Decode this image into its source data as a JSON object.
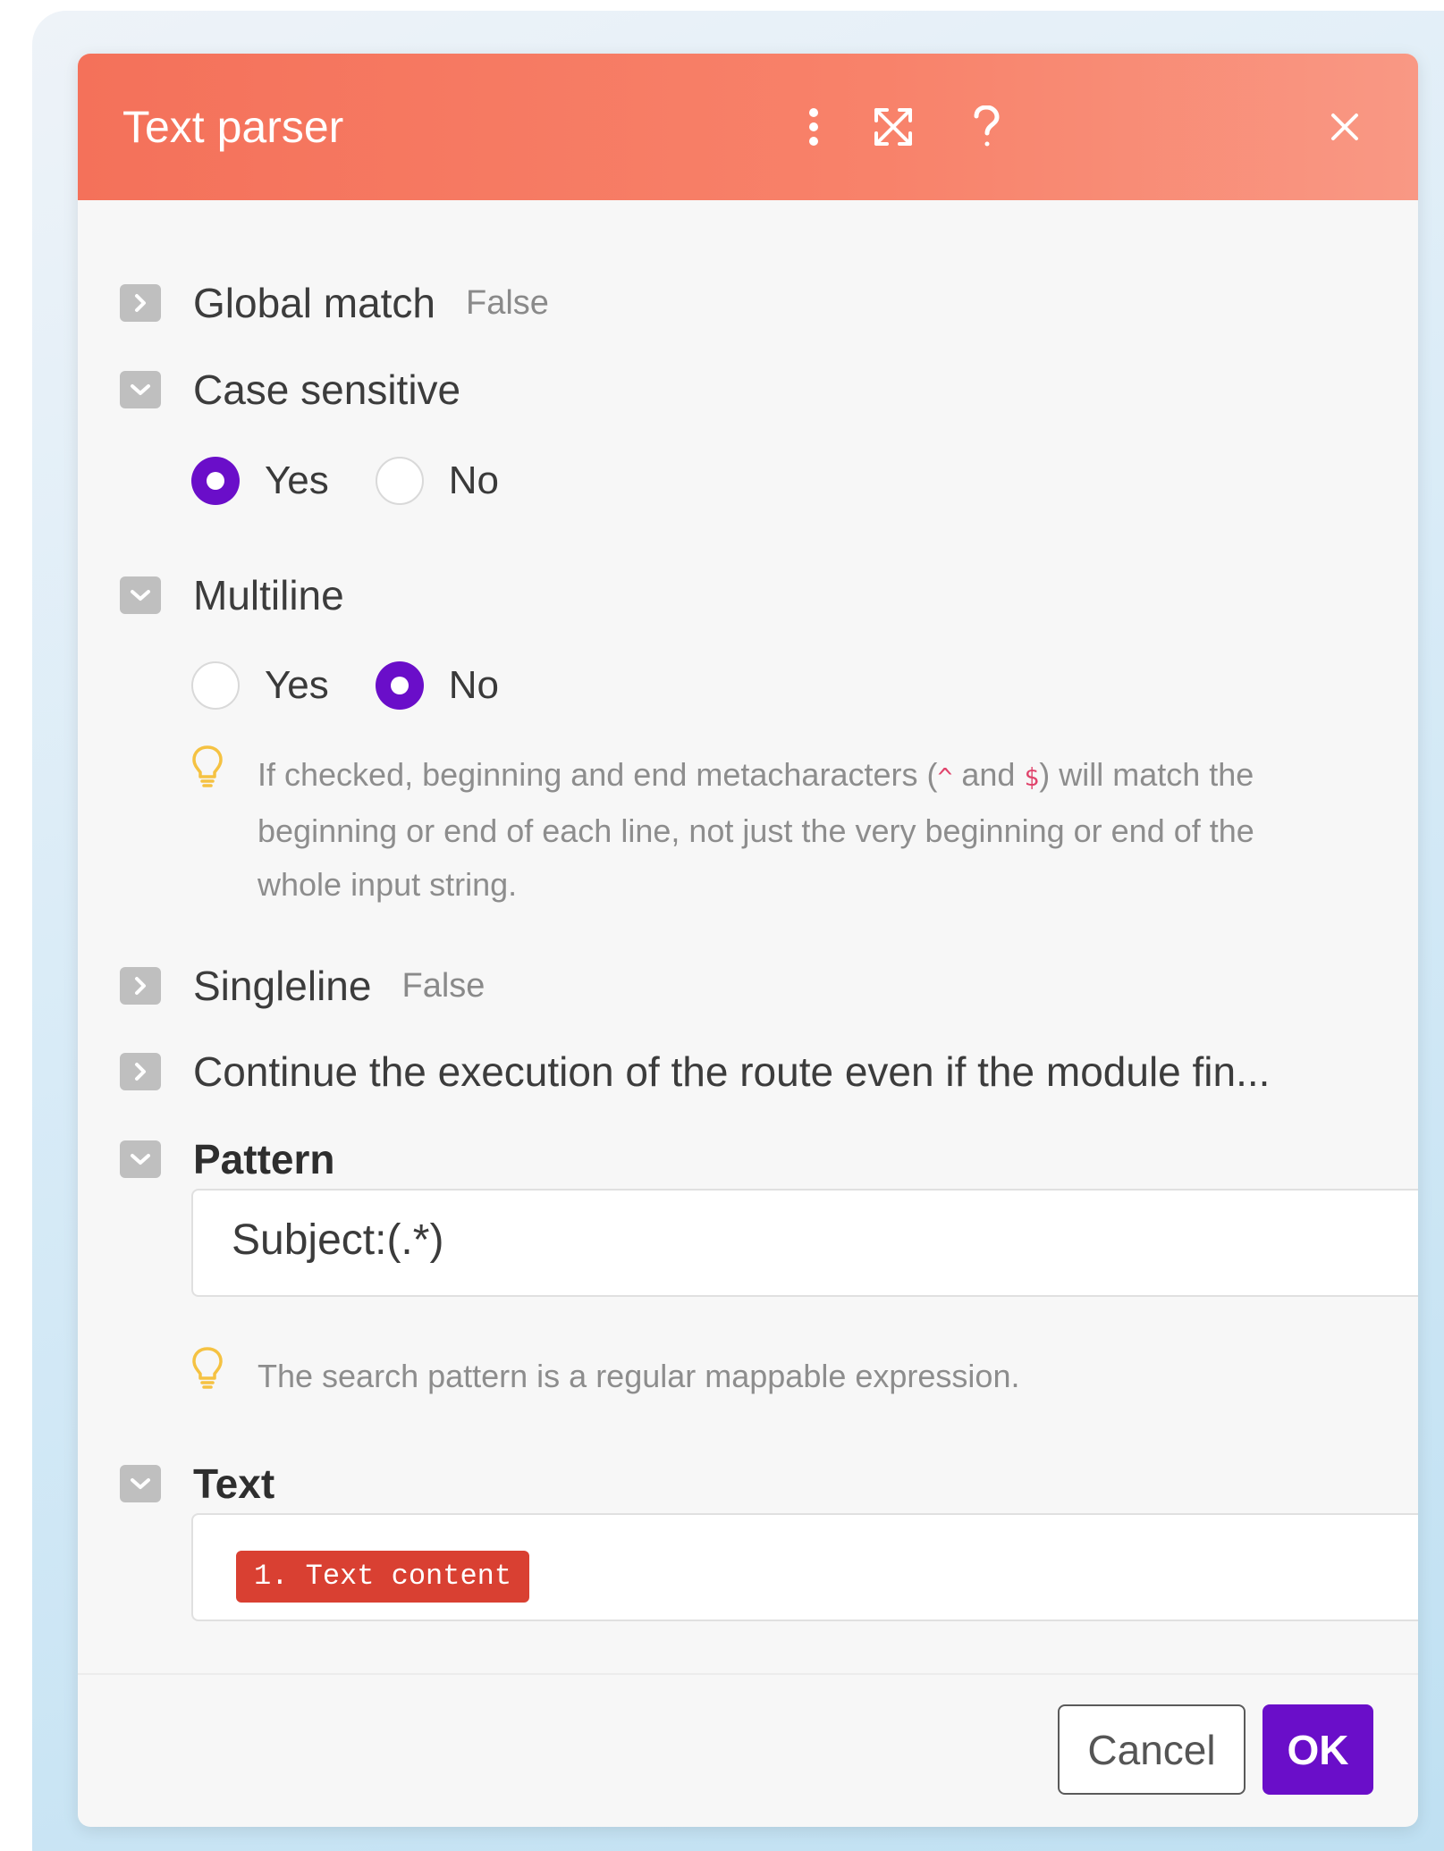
{
  "dialog": {
    "title": "Text parser",
    "header_icons": [
      "more-vertical-icon",
      "expand-icon",
      "help-icon",
      "close-icon"
    ]
  },
  "fields": {
    "global_match": {
      "label": "Global match",
      "value": "False"
    },
    "case_sensitive": {
      "label": "Case sensitive",
      "yes_label": "Yes",
      "no_label": "No",
      "selected": "Yes"
    },
    "multiline": {
      "label": "Multiline",
      "yes_label": "Yes",
      "no_label": "No",
      "selected": "No",
      "hint_part1": "If checked, beginning and end metacharacters (",
      "caret": "^",
      "hint_and": " and ",
      "dollar": "$",
      "hint_part2": ") will match the beginning or end of each line, not just the very beginning or end of the whole input string."
    },
    "singleline": {
      "label": "Singleline",
      "value": "False"
    },
    "continue_execution": {
      "label": "Continue the execution of the route even if the module fin..."
    },
    "pattern": {
      "label": "Pattern",
      "value": "Subject:(.*)",
      "hint": "The search pattern is a regular mappable expression."
    },
    "text": {
      "label": "Text",
      "token": "1. Text content"
    }
  },
  "footer": {
    "cancel_label": "Cancel",
    "ok_label": "OK"
  },
  "colors": {
    "header_start": "#f4715a",
    "header_end": "#f99884",
    "accent": "#6a0ec9",
    "token": "#d94032",
    "hint_icon": "#f5c242"
  }
}
